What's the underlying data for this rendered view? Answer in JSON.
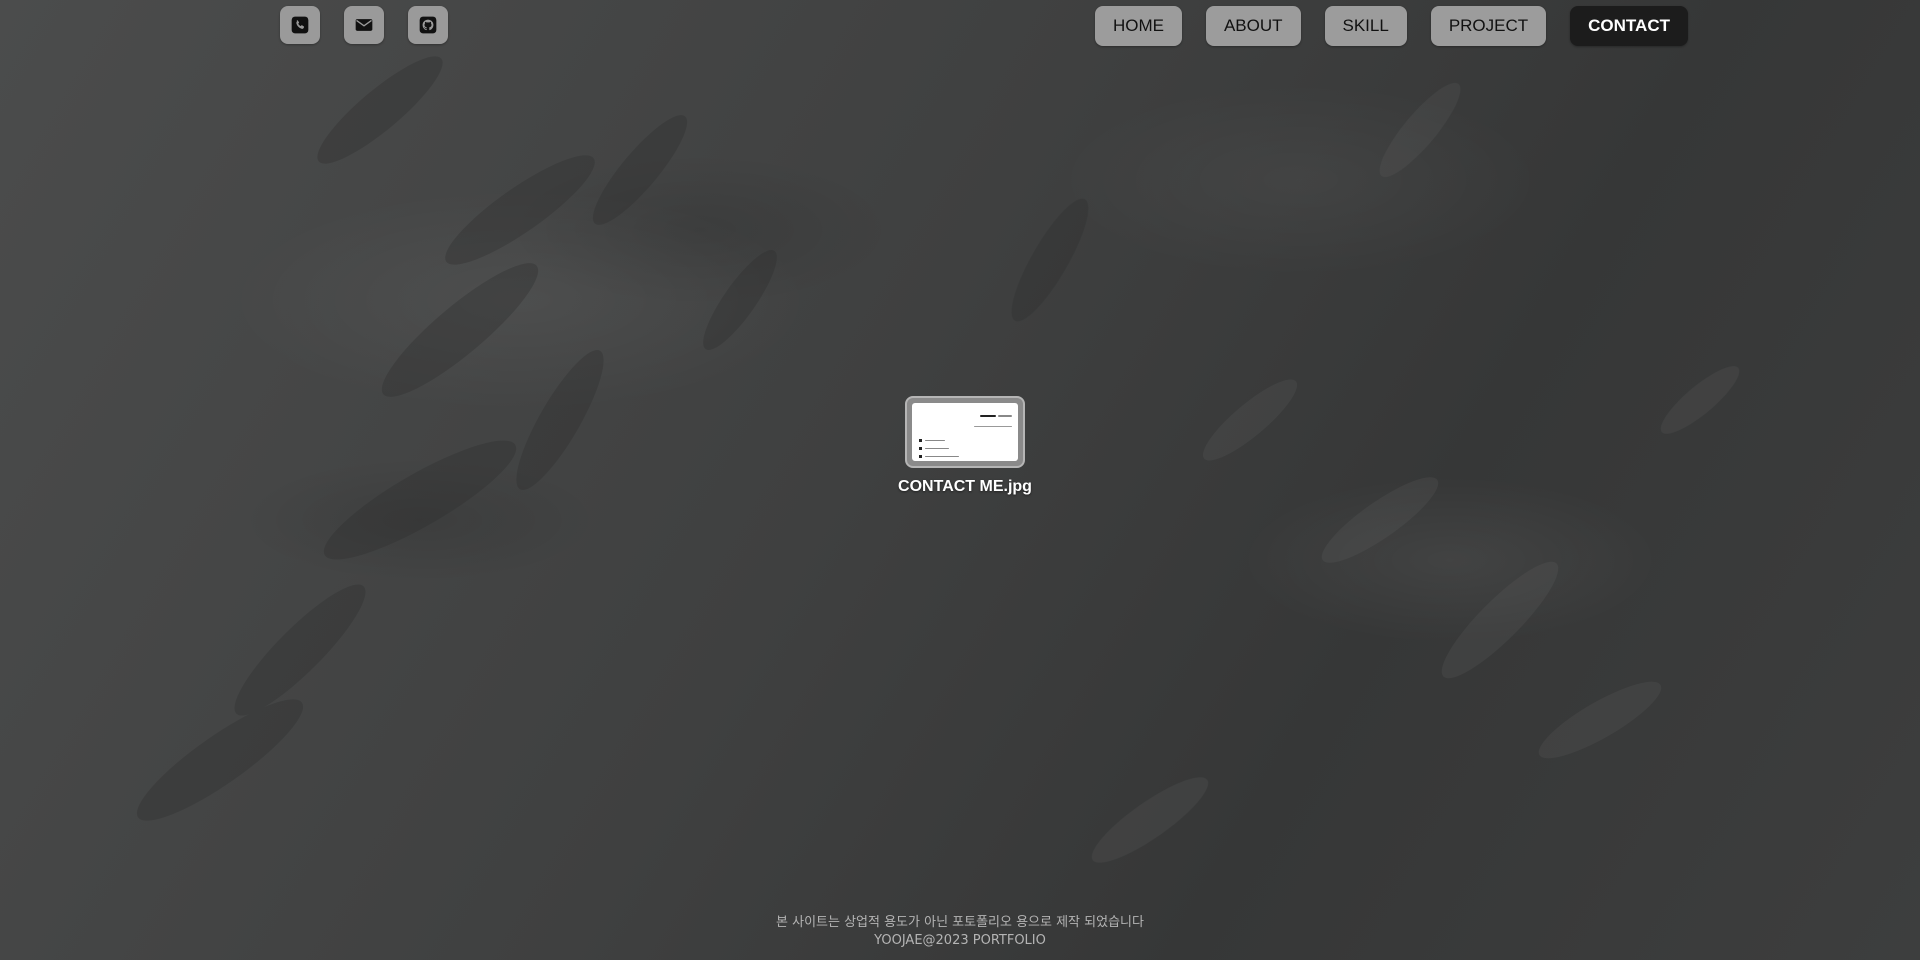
{
  "header": {
    "icons": [
      {
        "name": "phone-icon"
      },
      {
        "name": "mail-icon"
      },
      {
        "name": "github-icon"
      }
    ],
    "nav": [
      {
        "label": "HOME",
        "active": false
      },
      {
        "label": "ABOUT",
        "active": false
      },
      {
        "label": "SKILL",
        "active": false
      },
      {
        "label": "PROJECT",
        "active": false
      },
      {
        "label": "CONTACT",
        "active": true
      }
    ]
  },
  "desktop": {
    "file": {
      "name": "CONTACT ME.jpg"
    }
  },
  "footer": {
    "notice": "본 사이트는 상업적 용도가 아닌 포토폴리오 용으로 제작 되었습니다",
    "copyright": "YOOJAE@2023 PORTFOLIO"
  },
  "colors": {
    "background": "#434444",
    "button": "#9c9c9c",
    "active_button": "#1c1c1c",
    "footer_text": "#b4b4b4"
  }
}
